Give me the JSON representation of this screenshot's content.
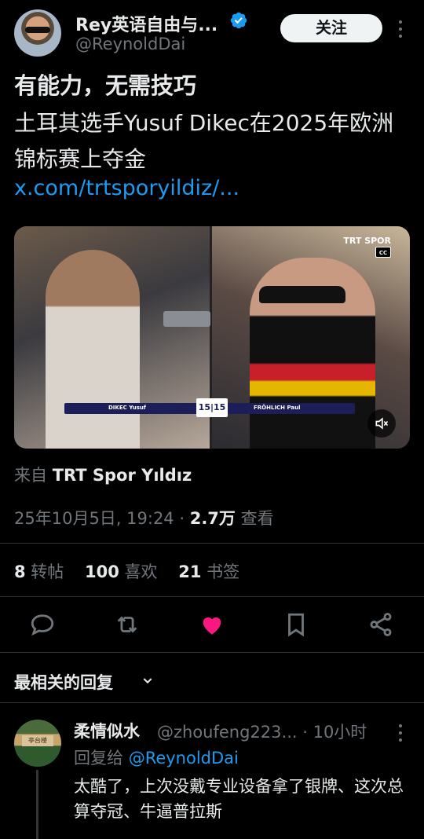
{
  "author": {
    "name": "Rey英语自由与...",
    "handle": "@ReynoldDai",
    "follow_label": "关注"
  },
  "tweet": {
    "line1": "有能力，无需技巧",
    "line2": "土耳其选手Yusuf Dikec在2025年欧洲锦标赛上夺金",
    "link": "x.com/trtsporyildiz/..."
  },
  "media": {
    "channel_logo": "TRT SPOR",
    "cc_label": "CC",
    "score_left_name": "DIKEC Yusuf",
    "score_right_name": "FRÖHLICH Paul",
    "score": "15|15"
  },
  "source": {
    "prefix": "来自",
    "name": "TRT Spor Yıldız"
  },
  "meta": {
    "datetime": "25年10月5日, 19:24 · ",
    "views_count": "2.7万",
    "views_label": " 查看"
  },
  "stats": {
    "reposts_count": "8",
    "reposts_label": " 转帖",
    "likes_count": "100",
    "likes_label": " 喜欢",
    "bookmarks_count": "21",
    "bookmarks_label": " 书签"
  },
  "replies_header": "最相关的回复",
  "reply": {
    "name": "柔情似水",
    "handle": "@zhoufeng223... · 10小时",
    "reply_to_prefix": "回复给 ",
    "reply_to_handle": "@ReynoldDai",
    "text": "太酷了，上次没戴专业设备拿了银牌、这次总算夺冠、牛逼普拉斯",
    "avatar_sign": "亭台楼"
  },
  "colors": {
    "accent": "#1d9bf0",
    "like": "#f91880",
    "muted": "#71767b"
  },
  "icons": [
    "verified-badge-icon",
    "more-vertical-icon",
    "reply-icon",
    "retweet-icon",
    "heart-icon",
    "bookmark-icon",
    "share-icon",
    "chevron-down-icon",
    "mute-icon"
  ]
}
